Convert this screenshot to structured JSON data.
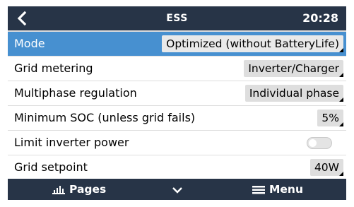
{
  "header": {
    "title": "ESS",
    "time": "20:28"
  },
  "rows": [
    {
      "label": "Mode",
      "value": "Optimized (without BatteryLife)",
      "selected": true
    },
    {
      "label": "Grid metering",
      "value": "Inverter/Charger"
    },
    {
      "label": "Multiphase regulation",
      "value": "Individual phase"
    },
    {
      "label": "Minimum SOC (unless grid fails)",
      "value": "5%"
    },
    {
      "label": "Limit inverter power",
      "toggle": false
    },
    {
      "label": "Grid setpoint",
      "value": "40W"
    }
  ],
  "footer": {
    "pages_label": "Pages",
    "menu_label": "Menu"
  },
  "colors": {
    "header_bg": "#273447",
    "selected_bg": "#4790d0",
    "value_bg": "#dedede"
  },
  "icons": {
    "back": "chevron-left-icon",
    "pages": "bar-chart-icon",
    "down": "chevron-down-icon",
    "menu": "hamburger-icon"
  }
}
